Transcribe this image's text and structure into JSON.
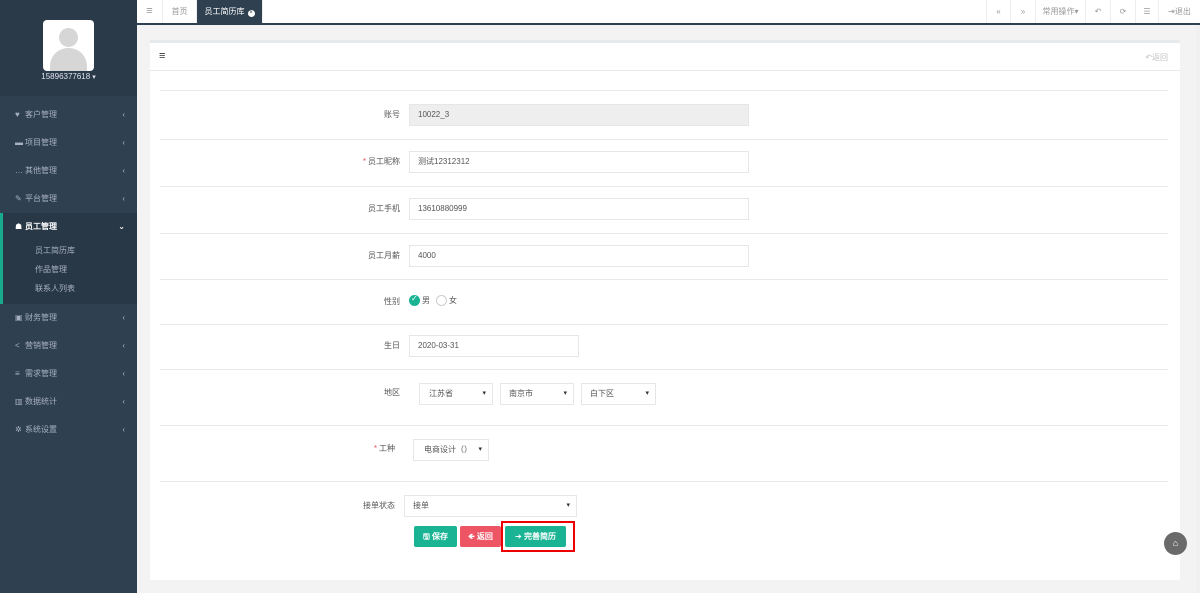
{
  "user": {
    "name": "15896377618",
    "caret": "▾"
  },
  "sidebar": {
    "items": [
      {
        "icon": "♥",
        "label": "客户管理"
      },
      {
        "icon": "▬",
        "label": "项目管理"
      },
      {
        "icon": "…",
        "label": "其他管理"
      },
      {
        "icon": "✎",
        "label": "平台管理"
      }
    ],
    "active": {
      "icon": "☗",
      "label": "员工管理",
      "sub": [
        "员工简历库",
        "作品管理",
        "联系人列表"
      ]
    },
    "items2": [
      {
        "icon": "▣",
        "label": "财务管理"
      },
      {
        "icon": "<",
        "label": "营销管理"
      },
      {
        "icon": "≡",
        "label": "需求管理"
      },
      {
        "icon": "▥",
        "label": "数据统计"
      },
      {
        "icon": "✲",
        "label": "系统设置"
      }
    ],
    "arrow": "‹",
    "arrow_down": "⌄"
  },
  "topbar": {
    "menu_icon": "≡",
    "tabs": [
      "首页",
      "员工简历库"
    ],
    "close": "×",
    "prev": "«",
    "next": "»",
    "common_ops": "常用操作▾",
    "undo": "↶",
    "refresh": "⟳",
    "list": "☰",
    "logout": "⇥退出"
  },
  "panel": {
    "menu_icon": "≡",
    "back": "↶返回"
  },
  "form": {
    "account_label": "账号",
    "account_value": "10022_3",
    "nickname_label": "员工昵称",
    "nickname_value": "测试12312312",
    "phone_label": "员工手机",
    "phone_value": "13610880999",
    "salary_label": "员工月薪",
    "salary_value": "4000",
    "gender_label": "性别",
    "gender_male": "男",
    "gender_female": "女",
    "birthday_label": "生日",
    "birthday_value": "2020-03-31",
    "region_label": "地区",
    "province": "江苏省",
    "city": "南京市",
    "district": "白下区",
    "worktype_label": "工种",
    "worktype_value": "电商设计（）",
    "status_label": "接单状态",
    "status_value": "接单",
    "required_mark": "*",
    "dropdown": "▾"
  },
  "buttons": {
    "save": "🖫 保存",
    "back": "🡸 返回",
    "complete": "➔ 完善简历"
  },
  "fab": "⌂",
  "colors": {
    "sidebar": "#2f4050",
    "accent": "#1ab394",
    "danger": "#ed5565"
  }
}
